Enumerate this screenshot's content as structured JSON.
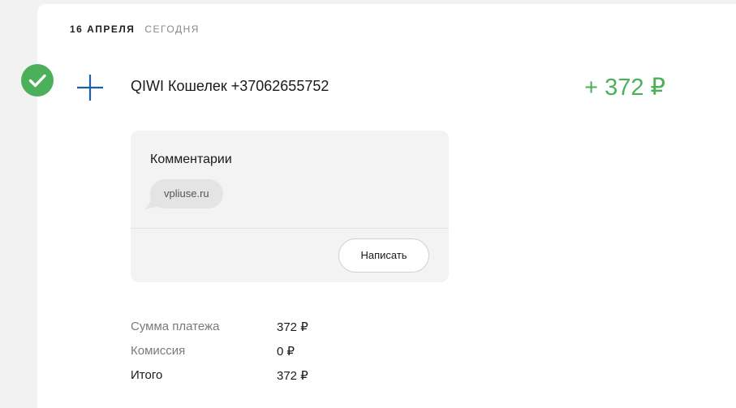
{
  "date": {
    "main": "16 АПРЕЛЯ",
    "relative": "СЕГОДНЯ"
  },
  "transaction": {
    "status_icon": "check-icon",
    "type_icon": "plus-icon",
    "title": "QIWI Кошелек +37062655752",
    "amount": "+ 372 ₽",
    "accent_color": "#4cb05a",
    "icon_color": "#1a5fa8"
  },
  "comments": {
    "title": "Комментарии",
    "items": [
      "vpliuse.ru"
    ],
    "write_button": "Написать"
  },
  "details": {
    "sum_label": "Сумма платежа",
    "sum_value": "372 ₽",
    "fee_label": "Комиссия",
    "fee_value": "0 ₽",
    "total_label": "Итого",
    "total_value": "372 ₽"
  }
}
